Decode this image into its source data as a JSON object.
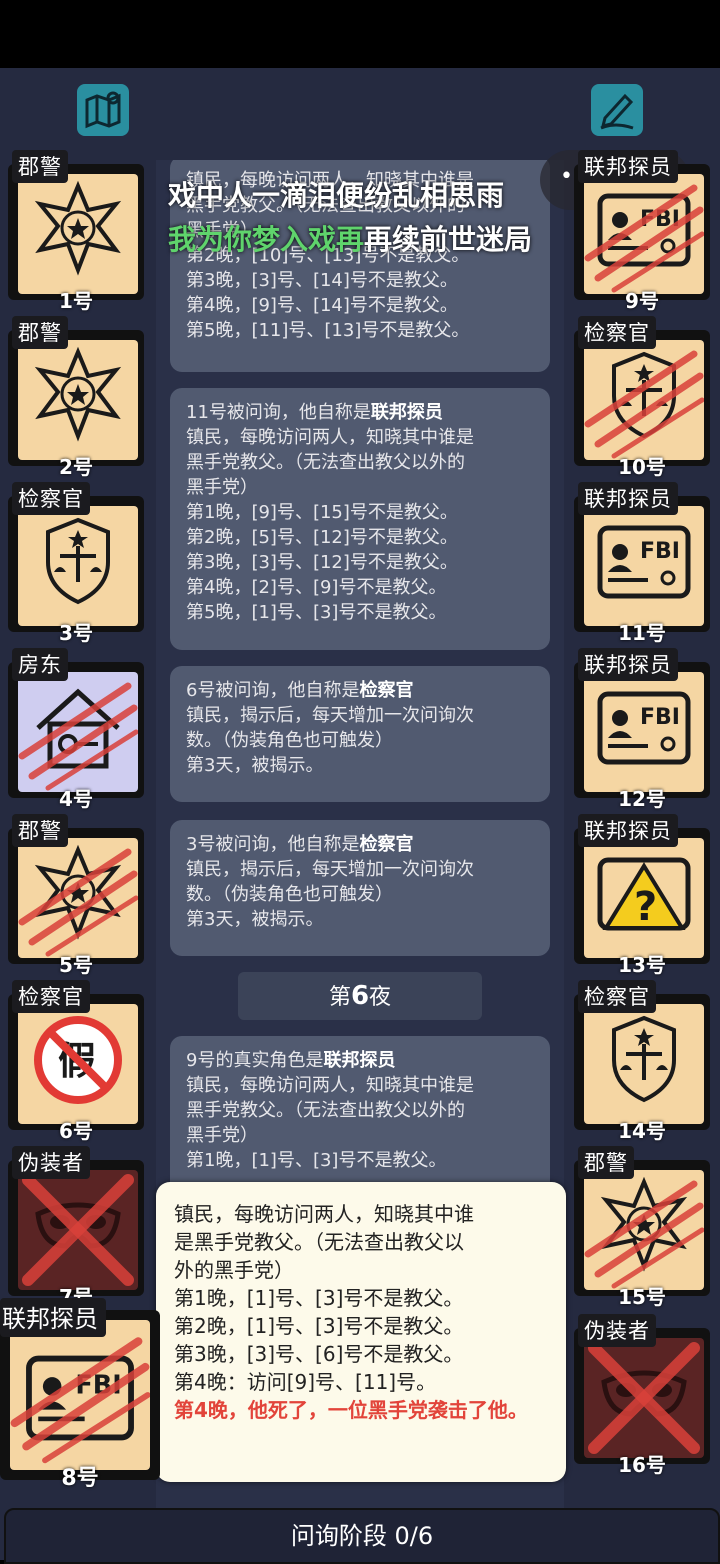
{
  "header": {
    "map_icon": "map-icon",
    "edit_icon": "edit-icon"
  },
  "overlay": {
    "line1": "戏中人一滴泪便纷乱相思雨",
    "line2_green": "我为你梦入戏再",
    "line2_white": "再续前世迷局"
  },
  "left_cards": [
    {
      "role": "郡警",
      "num": "1号",
      "icon": "sheriff-badge-icon"
    },
    {
      "role": "郡警",
      "num": "2号",
      "icon": "sheriff-badge-icon"
    },
    {
      "role": "检察官",
      "num": "3号",
      "icon": "prosecutor-emblem-icon"
    },
    {
      "role": "房东",
      "num": "4号",
      "icon": "house-key-icon"
    },
    {
      "role": "郡警",
      "num": "5号",
      "icon": "sheriff-badge-icon"
    },
    {
      "role": "检察官",
      "num": "6号",
      "icon": "fake-stamp-icon"
    },
    {
      "role": "伪装者",
      "num": "7号",
      "icon": "mask-icon"
    },
    {
      "role": "联邦探员",
      "num": "8号",
      "icon": "fbi-badge-icon"
    }
  ],
  "right_cards": [
    {
      "role": "联邦探员",
      "num": "9号",
      "icon": "fbi-badge-icon"
    },
    {
      "role": "检察官",
      "num": "10号",
      "icon": "prosecutor-emblem-icon"
    },
    {
      "role": "联邦探员",
      "num": "11号",
      "icon": "fbi-badge-icon"
    },
    {
      "role": "联邦探员",
      "num": "12号",
      "icon": "fbi-badge-icon"
    },
    {
      "role": "联邦探员",
      "num": "13号",
      "icon": "fbi-question-icon"
    },
    {
      "role": "检察官",
      "num": "14号",
      "icon": "prosecutor-emblem-icon"
    },
    {
      "role": "郡警",
      "num": "15号",
      "icon": "sheriff-badge-icon"
    },
    {
      "role": "伪装者",
      "num": "16号",
      "icon": "mask-icon"
    }
  ],
  "feed": {
    "msg1": {
      "l1": "镇民，每晚访问两人，知晓其中谁是",
      "l2": "黑手党教父。（无法查出教父以外的",
      "l3": "黑手党）",
      "l4": "第2晚，[10]号、[13]号不是教父。",
      "l5": "第3晚，[3]号、[14]号不是教父。",
      "l6": "第4晚，[9]号、[14]号不是教父。",
      "l7": "第5晚，[11]号、[13]号不是教父。"
    },
    "msg2": {
      "head": "11号被问询，他自称是",
      "role": "联邦探员",
      "l1": "镇民，每晚访问两人，知晓其中谁是",
      "l2": "黑手党教父。（无法查出教父以外的",
      "l3": "黑手党）",
      "l4": "第1晚，[9]号、[15]号不是教父。",
      "l5": "第2晚，[5]号、[12]号不是教父。",
      "l6": "第3晚，[3]号、[12]号不是教父。",
      "l7": "第4晚，[2]号、[9]号不是教父。",
      "l8": "第5晚，[1]号、[3]号不是教父。"
    },
    "msg3": {
      "head": "6号被问询，他自称是",
      "role": "检察官",
      "l1": "镇民，揭示后，每天增加一次问询次",
      "l2": "数。（伪装角色也可触发）",
      "l3": "第3天，被揭示。"
    },
    "msg4": {
      "head": "3号被问询，他自称是",
      "role": "检察官",
      "l1": "镇民，揭示后，每天增加一次问询次",
      "l2": "数。（伪装角色也可触发）",
      "l3": "第3天，被揭示。"
    },
    "night": {
      "pre": "第",
      "n": "6",
      "post": "夜"
    },
    "msg5": {
      "head": "9号的真实角色是",
      "role": "联邦探员",
      "l1": "镇民，每晚访问两人，知晓其中谁是",
      "l2": "黑手党教父。（无法查出教父以外的",
      "l3": "黑手党）",
      "l4": "第1晚，[1]号、[3]号不是教父。"
    }
  },
  "popup": {
    "l1": "镇民，每晚访问两人，知晓其中谁",
    "l2": "是黑手党教父。（无法查出教父以",
    "l3": "外的黑手党）",
    "l4": "第1晚，[1]号、[3]号不是教父。",
    "l5": "第2晚，[1]号、[3]号不是教父。",
    "l6": "第3晚，[3]号、[6]号不是教父。",
    "l7": "第4晚：访问[9]号、[11]号。",
    "red": "第4晚，他死了，一位黑手党袭击了他。"
  },
  "footer": {
    "phase": "问询阶段 0/6"
  },
  "colors": {
    "board": "#252a40",
    "card": "#f5d6a3",
    "message": "#515a70",
    "popup": "#fdfaea",
    "red": "#e2443a"
  }
}
